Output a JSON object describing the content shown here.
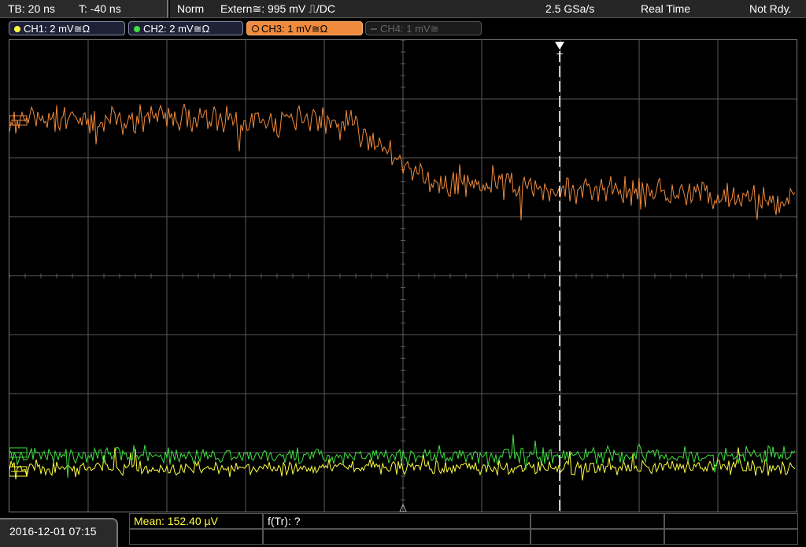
{
  "topbar": {
    "timebase": "TB: 20 ns",
    "trigger_pos": "T: -40 ns",
    "trigger_mode": "Norm",
    "trigger_source": "Extern≅: 995 mV ⎍/DC",
    "sample_rate": "2.5 GSa/s",
    "acq_mode": "Real Time",
    "status": "Not Rdy."
  },
  "channels": [
    {
      "label": "CH1: 2 mV≅Ω",
      "color": "#ffff40",
      "active": true
    },
    {
      "label": "CH2: 2 mV≅Ω",
      "color": "#40e040",
      "active": true
    },
    {
      "label": "CH3: 1 mV≅Ω",
      "color": "#f08a3c",
      "active": true,
      "selected": true
    },
    {
      "label": "CH4: 1 mV≅",
      "color": "#555555",
      "active": false
    }
  ],
  "display": {
    "trigger_marker": "T",
    "trigger_level_marker": "T",
    "ch_marker": "",
    "colors": {
      "grid": "#5a5a5a",
      "ch1": "#ffff40",
      "ch2": "#40e040",
      "ch3": "#f08a3c",
      "trigger_line": "#ffffff"
    }
  },
  "bottombar": {
    "datetime": "2016-12-01 07:15",
    "mean": "Mean: 152.40 µV",
    "f_tr": "f(Tr): ?"
  }
}
